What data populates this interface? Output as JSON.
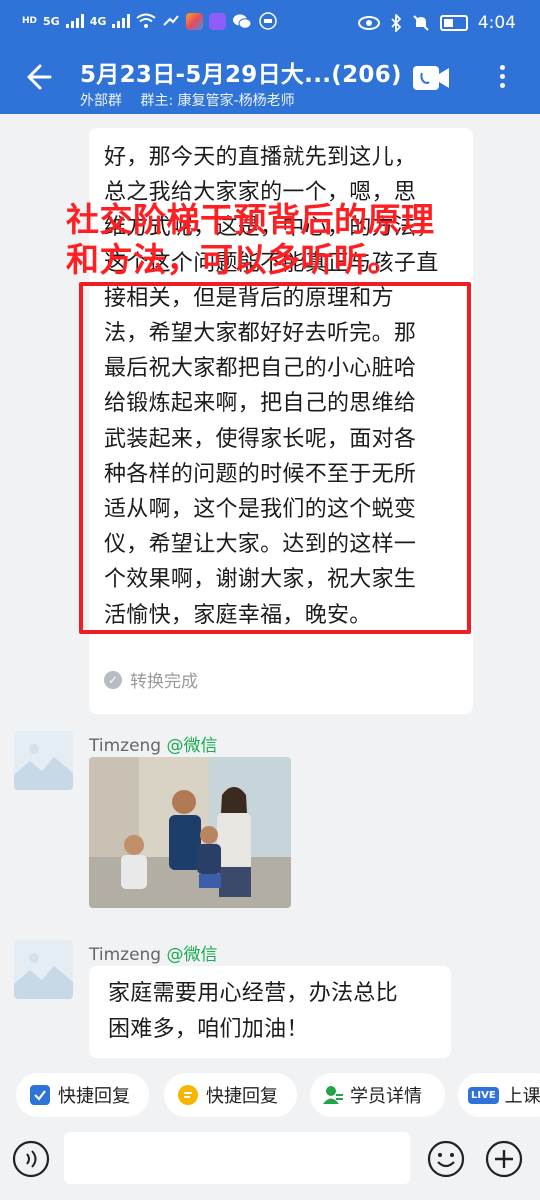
{
  "status_bar": {
    "hd_labels": [
      "HD",
      "HD"
    ],
    "net_labels": [
      "5G",
      "4G"
    ],
    "time": "4:04"
  },
  "header": {
    "title": "5月23日-5月29日大...(206)",
    "group_type": "外部群",
    "owner": "群主: 康复管家-杨杨老师"
  },
  "messages": [
    {
      "lines": [
        "好，那今天的直播就先到这儿，",
        "总之我给大家家的一个，嗯，思",
        "维方式呢，这是，中心，的方法，",
        "这个这个问题能不能真正与孩子直",
        "接相关，但是背后的原理和方",
        "法，希望大家都好好去听完。那",
        "最后祝大家都把自己的小心脏哈",
        "给锻炼起来啊，把自己的思维给",
        "武装起来，使得家长呢，面对各",
        "种各样的问题的时候不至于无所",
        "适从啊，这个是我们的这个蜕变",
        "仪，希望让大家。达到的这样一",
        "个效果啊，谢谢大家，祝大家生",
        "活愉快，家庭幸福，晚安。"
      ],
      "status": "转换完成"
    },
    {
      "sender": "Timzeng",
      "tag": "@微信"
    },
    {
      "sender": "Timzeng",
      "tag": "@微信",
      "lines": [
        "家庭需要用心经营，办法总比",
        "困难多，咱们加油！"
      ]
    }
  ],
  "annotation": {
    "lines": [
      "社交阶梯干预背后的原理",
      "和方法，可以多听听。"
    ],
    "color": "#ff1f22"
  },
  "quick_replies": [
    "快捷回复",
    "快捷回复",
    "学员详情",
    "上课"
  ],
  "live_badge": "LIVE",
  "input": {
    "value": "",
    "placeholder": ""
  },
  "colors": {
    "header": "#2f73d8",
    "tag": "#1aad4f",
    "annotation_box": "#ee1e24"
  }
}
